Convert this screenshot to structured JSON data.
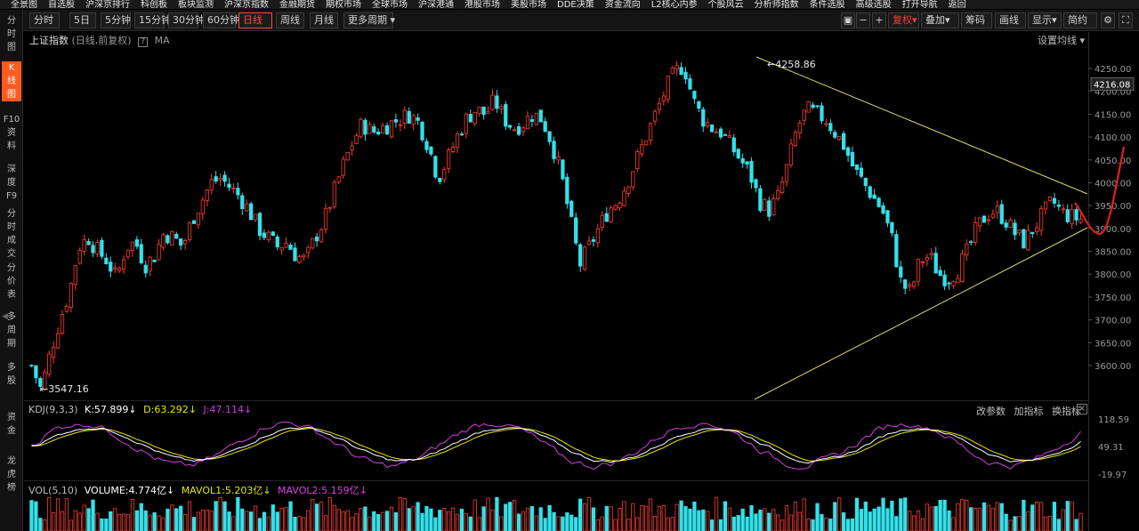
{
  "top_menu": [
    "全景图",
    "自选股",
    "沪深京排行",
    "科创板",
    "板块监测",
    "沪深京指数",
    "金融期货",
    "期权市场",
    "全球市场",
    "沪深港通",
    "港股市场",
    "美股市场",
    "DDE决策",
    "资金流向",
    "L2核心内参",
    "个股风云",
    "分析师指数",
    "条件选股",
    "高级选股",
    "打开导航",
    "返回"
  ],
  "toolbar": {
    "periods": [
      "分时",
      "5日",
      "5分钟",
      "15分钟",
      "30分钟",
      "60分钟",
      "日线",
      "周线",
      "月线",
      "更多周期"
    ],
    "active_period": "日线",
    "right": [
      "复权",
      "叠加",
      "筹码",
      "画线",
      "显示",
      "简约"
    ]
  },
  "sidebar": [
    {
      "label": "分时图",
      "active": false
    },
    {
      "label": "K线图",
      "active": true
    },
    {
      "label": "F10资料",
      "active": false
    },
    {
      "label": "深度F9",
      "active": false
    },
    {
      "label": "分时成交",
      "active": false
    },
    {
      "label": "分价表",
      "active": false
    },
    {
      "label": "多周期",
      "active": false
    },
    {
      "label": "多股",
      "active": false
    },
    {
      "label": "资金",
      "active": false
    },
    {
      "label": "龙虎榜",
      "active": false
    }
  ],
  "chart": {
    "title": "上证指数",
    "subtitle": "(日线,前复权)",
    "help": "?",
    "ma_label": "MA",
    "ma_setting": "设置均线",
    "high_label": "4258.86",
    "low_label": "3547.16",
    "current_price": "4216.08",
    "y_ticks": [
      "4250.00",
      "4200.00",
      "4150.00",
      "4100.00",
      "4050.00",
      "4000.00",
      "3950.00",
      "3900.00",
      "3850.00",
      "3800.00",
      "3750.00",
      "3700.00",
      "3650.00",
      "3600.00"
    ]
  },
  "kdj": {
    "name": "KDJ(9,3,3)",
    "k": "K:57.899",
    "d": "D:63.292",
    "j": "J:47.114",
    "links": [
      "改参数",
      "加指标",
      "换指标"
    ],
    "close": "×",
    "y_ticks": [
      "118.59",
      "49.31",
      "-19.97"
    ]
  },
  "vol": {
    "name": "VOL(5,10)",
    "volume": "VOLUME:4.774亿",
    "mavol1": "MAVOL1:5.203亿",
    "mavol2": "MAVOL2:5.159亿"
  },
  "colors": {
    "up": "#ff3b30",
    "down": "#33e1ea",
    "trend": "#d8d870",
    "k": "#ffffff",
    "d": "#e6e600",
    "j": "#d23ce0",
    "mavol2": "#e040e0",
    "accent": "#ff5a1f"
  },
  "chart_data": {
    "type": "candlestick",
    "title": "上证指数",
    "ylim": [
      3520,
      4275
    ],
    "close_path": [
      3600,
      3547,
      3630,
      3700,
      3760,
      3860,
      3880,
      3850,
      3830,
      3790,
      3860,
      3870,
      3820,
      3840,
      3890,
      3880,
      3860,
      3920,
      3960,
      4000,
      4010,
      3990,
      3970,
      3940,
      3900,
      3880,
      3860,
      3870,
      3840,
      3830,
      3880,
      3920,
      3980,
      4040,
      4090,
      4130,
      4110,
      4120,
      4130,
      4140,
      4150,
      4130,
      4080,
      4010,
      4050,
      4100,
      4140,
      4160,
      4150,
      4180,
      4140,
      4120,
      4130,
      4150,
      4140,
      4090,
      4020,
      3920,
      3820,
      3860,
      3900,
      3940,
      3960,
      4000,
      4050,
      4100,
      4150,
      4200,
      4240,
      4258,
      4180,
      4140,
      4120,
      4110,
      4080,
      4050,
      4020,
      3960,
      3940,
      3970,
      4040,
      4120,
      4160,
      4150,
      4140,
      4110,
      4080,
      4030,
      4000,
      3970,
      3940,
      3880,
      3780,
      3760,
      3830,
      3840,
      3800,
      3790,
      3810,
      3850,
      3900,
      3930,
      3940,
      3920,
      3890,
      3870,
      3900,
      3930,
      3960,
      3935,
      3925,
      3920
    ]
  }
}
